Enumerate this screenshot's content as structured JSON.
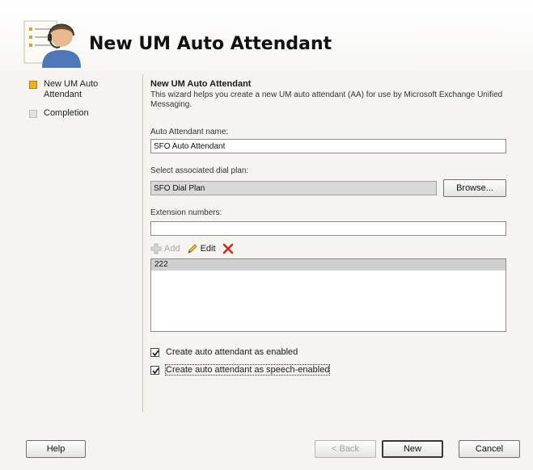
{
  "window": {
    "title": "New UM Auto Attendant",
    "icon": "user-headset-icon"
  },
  "sidebar": {
    "steps": [
      {
        "label": "New UM Auto Attendant",
        "state": "current"
      },
      {
        "label": "Completion",
        "state": "pending"
      }
    ]
  },
  "main": {
    "heading": "New UM Auto Attendant",
    "description": "This wizard helps you create a new UM auto attendant (AA) for use by Microsoft Exchange Unified Messaging.",
    "aa_name_label": "Auto Attendant name:",
    "aa_name_value": "SFO Auto Attendant",
    "dial_plan_label": "Select associated dial plan:",
    "dial_plan_value": "SFO Dial Plan",
    "browse_label": "Browse...",
    "extension_label": "Extension numbers:",
    "extension_value": "",
    "toolbar": {
      "add_label": "Add",
      "edit_label": "Edit",
      "add_icon": "add-icon",
      "edit_icon": "pencil-icon",
      "remove_icon": "delete-x-icon"
    },
    "extensions": [
      "222"
    ],
    "checkbox_enabled_label": "Create auto attendant as enabled",
    "checkbox_enabled_checked": true,
    "checkbox_speech_label": "Create auto attendant as speech-enabled",
    "checkbox_speech_checked": true
  },
  "footer": {
    "help_label": "Help",
    "back_label": "< Back",
    "new_label": "New",
    "cancel_label": "Cancel"
  },
  "colors": {
    "step_active": "#f0b020",
    "step_inactive": "#e2e2e2",
    "delete_red": "#d4261b",
    "background": "#f5f4f0"
  }
}
